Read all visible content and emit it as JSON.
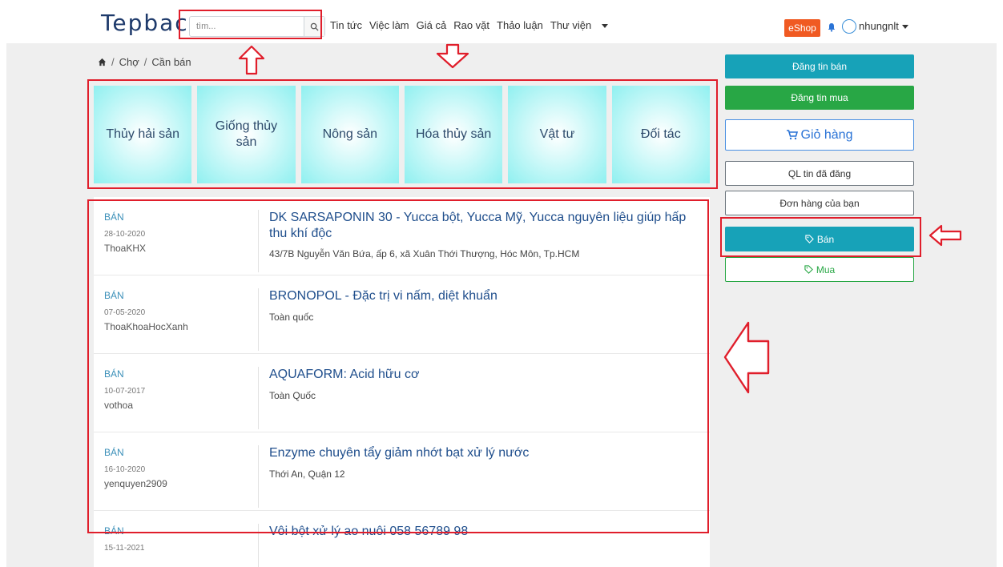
{
  "header": {
    "logo_text": "Tepbac",
    "search": {
      "placeholder": "tìm...",
      "value": ""
    },
    "nav": [
      "Tin tức",
      "Việc làm",
      "Giá cả",
      "Rao vặt",
      "Thảo luận",
      "Thư viện"
    ],
    "eshop_label": "eShop",
    "username": "nhungnlt"
  },
  "breadcrumb": [
    "Chợ",
    "Cần bán"
  ],
  "categories": [
    "Thủy hải sản",
    "Giống thủy sản",
    "Nông sản",
    "Hóa thủy sản",
    "Vật tư",
    "Đối tác"
  ],
  "listings": [
    {
      "type": "BÁN",
      "date": "28-10-2020",
      "user": "ThoaKHX",
      "title": "DK SARSAPONIN 30 - Yucca bột, Yucca Mỹ, Yucca nguyên liệu giúp hấp thu khí độc",
      "location": "43/7B Nguyễn Văn Bứa, ấp 6, xã Xuân Thới Thượng, Hóc Môn, Tp.HCM"
    },
    {
      "type": "BÁN",
      "date": "07-05-2020",
      "user": "ThoaKhoaHocXanh",
      "title": "BRONOPOL - Đặc trị vi nấm, diệt khuẩn",
      "location": "Toàn quốc"
    },
    {
      "type": "BÁN",
      "date": "10-07-2017",
      "user": "vothoa",
      "title": "AQUAFORM: Acid hữu cơ",
      "location": "Toàn Quốc"
    },
    {
      "type": "BÁN",
      "date": "16-10-2020",
      "user": "yenquyen2909",
      "title": "Enzyme chuyên tẩy giảm nhớt bạt xử lý nước",
      "location": "Thới An, Quận 12"
    },
    {
      "type": "BÁN",
      "date": "15-11-2021",
      "user": "",
      "title": "Vôi bột xử lý ao nuôi 058 56789 98",
      "location": ""
    }
  ],
  "sidebar": {
    "post_sell": "Đăng tin bán",
    "post_buy": "Đăng tin mua",
    "cart": "Giỏ hàng",
    "manage_posts": "QL tin đã đăng",
    "your_orders": "Đơn hàng của bạn",
    "sell": "Bán",
    "buy": "Mua"
  },
  "colors": {
    "accent_teal": "#17a2b8",
    "green": "#28a745",
    "eshop": "#f05a22",
    "annotation": "#e01e2b"
  }
}
